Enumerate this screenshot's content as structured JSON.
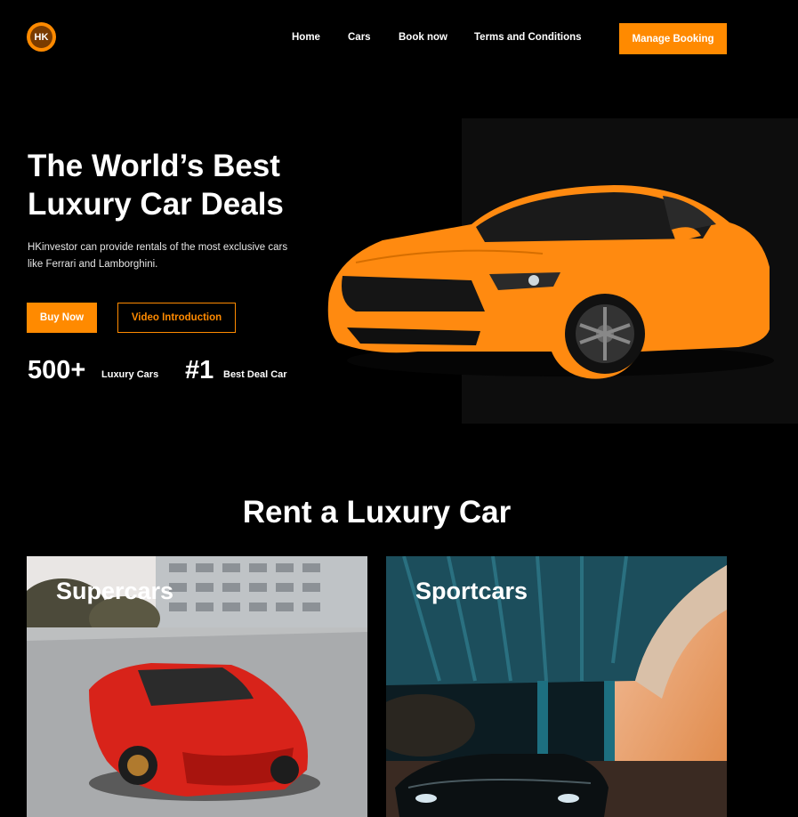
{
  "header": {
    "logo_text": "HK",
    "nav": [
      "Home",
      "Cars",
      "Book now",
      "Terms and Conditions"
    ],
    "cta": "Manage Booking"
  },
  "hero": {
    "title_line1": "The World’s Best",
    "title_line2": "Luxury Car Deals",
    "subtitle_line1": "HKinvestor can provide rentals of the most exclusive cars",
    "subtitle_line2": "like Ferrari and Lamborghini.",
    "buy_label": "Buy Now",
    "video_label": "Video Introduction",
    "stats": [
      {
        "value": "500+",
        "label": "Luxury Cars"
      },
      {
        "value": "#1",
        "label": "Best Deal Car"
      }
    ]
  },
  "section": {
    "title": "Rent a Luxury Car",
    "cards": [
      {
        "title": "Supercars"
      },
      {
        "title": "Sportcars"
      }
    ]
  },
  "colors": {
    "accent": "#ff8a00",
    "background": "#000000"
  }
}
